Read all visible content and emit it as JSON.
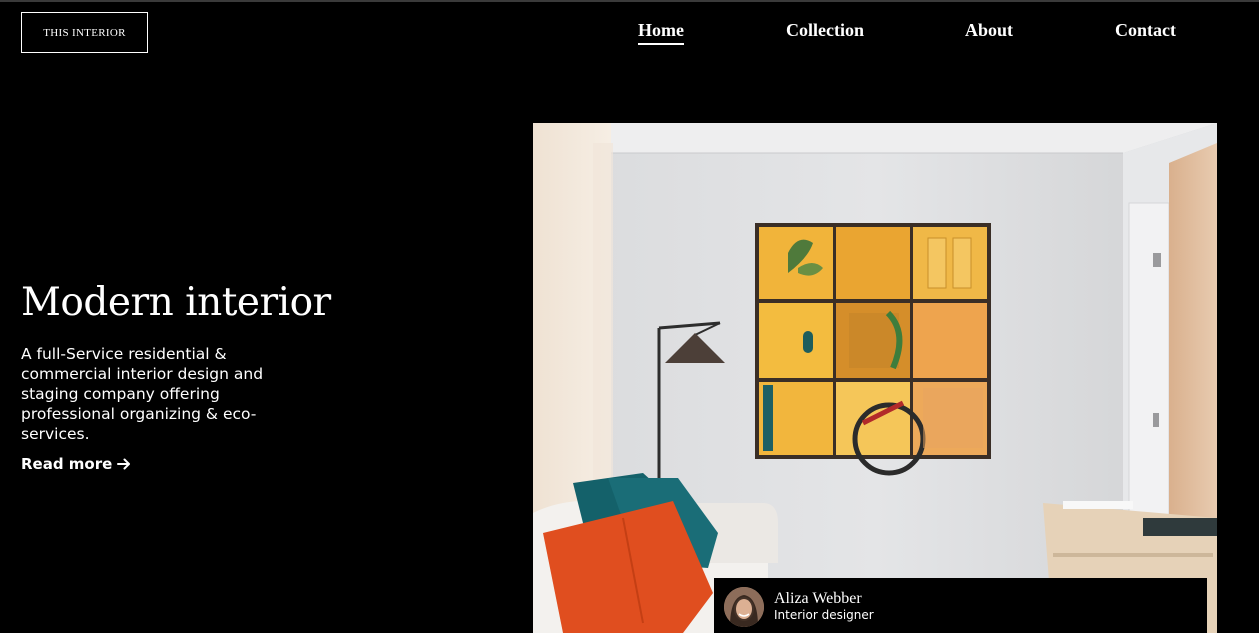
{
  "header": {
    "logo": "THIS INTERIOR",
    "nav": [
      {
        "label": "Home",
        "active": true
      },
      {
        "label": "Collection",
        "active": false
      },
      {
        "label": "About",
        "active": false
      },
      {
        "label": "Contact",
        "active": false
      }
    ]
  },
  "hero": {
    "title": "Modern interior",
    "description": "A full-Service residential & commercial interior design and staging company offering professional organizing & eco-services.",
    "cta_label": "Read more",
    "cta_icon": "arrow-right-icon"
  },
  "author": {
    "name": "Aliza Webber",
    "role": "Interior designer"
  },
  "colors": {
    "background": "#000000",
    "text": "#ffffff",
    "pillow_orange": "#e04e1f",
    "pillow_teal": "#14616a",
    "art_yellow": "#f1b43a"
  }
}
